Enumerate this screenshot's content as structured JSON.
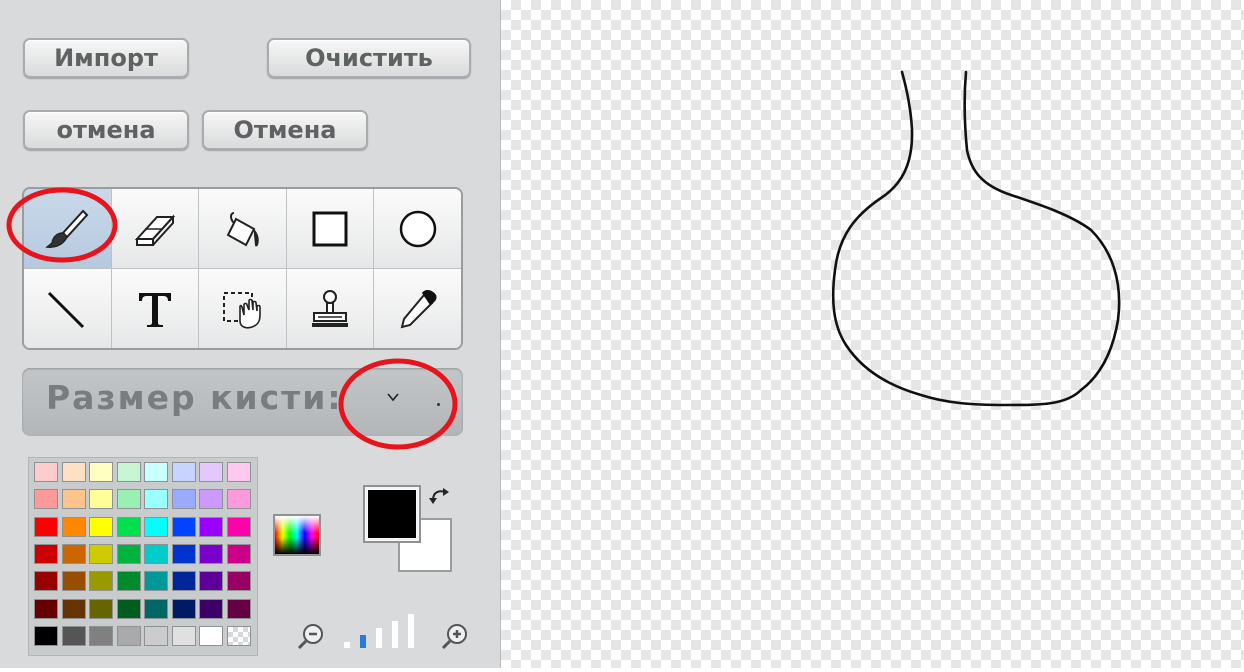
{
  "toolbar": {
    "import_label": "Импорт",
    "clear_label": "Очистить",
    "undo_label": "отмена",
    "redo_label": "Отмена"
  },
  "tools": [
    {
      "name": "brush-tool",
      "icon": "paintbrush-icon",
      "active": true
    },
    {
      "name": "eraser-tool",
      "icon": "eraser-icon",
      "active": false
    },
    {
      "name": "fill-tool",
      "icon": "paint-bucket-icon",
      "active": false
    },
    {
      "name": "rectangle-tool",
      "icon": "rectangle-icon",
      "active": false
    },
    {
      "name": "ellipse-tool",
      "icon": "ellipse-icon",
      "active": false
    },
    {
      "name": "line-tool",
      "icon": "line-icon",
      "active": false
    },
    {
      "name": "text-tool",
      "icon": "text-icon",
      "active": false
    },
    {
      "name": "select-tool",
      "icon": "select-hand-icon",
      "active": false
    },
    {
      "name": "stamp-tool",
      "icon": "stamp-icon",
      "active": false
    },
    {
      "name": "eyedropper-tool",
      "icon": "eyedropper-icon",
      "active": false
    }
  ],
  "brush_size": {
    "label": "Размер кисти:",
    "icon": "chevron-down-icon"
  },
  "palette": {
    "rows": [
      [
        "#ffcccc",
        "#ffe0c2",
        "#ffffc2",
        "#c8f5d4",
        "#c8ffff",
        "#c8d4ff",
        "#e2c8ff",
        "#ffc8ee"
      ],
      [
        "#ff9999",
        "#ffc38c",
        "#ffff99",
        "#99f0b3",
        "#99ffff",
        "#99aaff",
        "#cc99ff",
        "#ff99dd"
      ],
      [
        "#ff0000",
        "#ff8800",
        "#ffff00",
        "#00e04f",
        "#00ffff",
        "#0044ff",
        "#9900ff",
        "#ff00aa"
      ],
      [
        "#cc0000",
        "#cc6600",
        "#cccc00",
        "#00b33c",
        "#00cccc",
        "#0033cc",
        "#7a00cc",
        "#cc0088"
      ],
      [
        "#990000",
        "#994d00",
        "#999900",
        "#008a2e",
        "#009999",
        "#002699",
        "#5c0099",
        "#990066"
      ],
      [
        "#660000",
        "#663300",
        "#666600",
        "#005c1f",
        "#006666",
        "#001a66",
        "#3d0066",
        "#660044"
      ],
      [
        "#000000",
        "#555555",
        "#808080",
        "#aaaaaa",
        "#cccccc",
        "#e0e0e0",
        "#ffffff",
        "checker"
      ]
    ]
  },
  "colors": {
    "foreground": "#000000",
    "background": "#ffffff",
    "highlight": "#e8131b",
    "active_tool": "#b9cde2"
  },
  "zoom": {
    "levels": 5,
    "current": 2,
    "zoom_out_icon": "zoom-out-icon",
    "zoom_in_icon": "zoom-in-icon"
  }
}
